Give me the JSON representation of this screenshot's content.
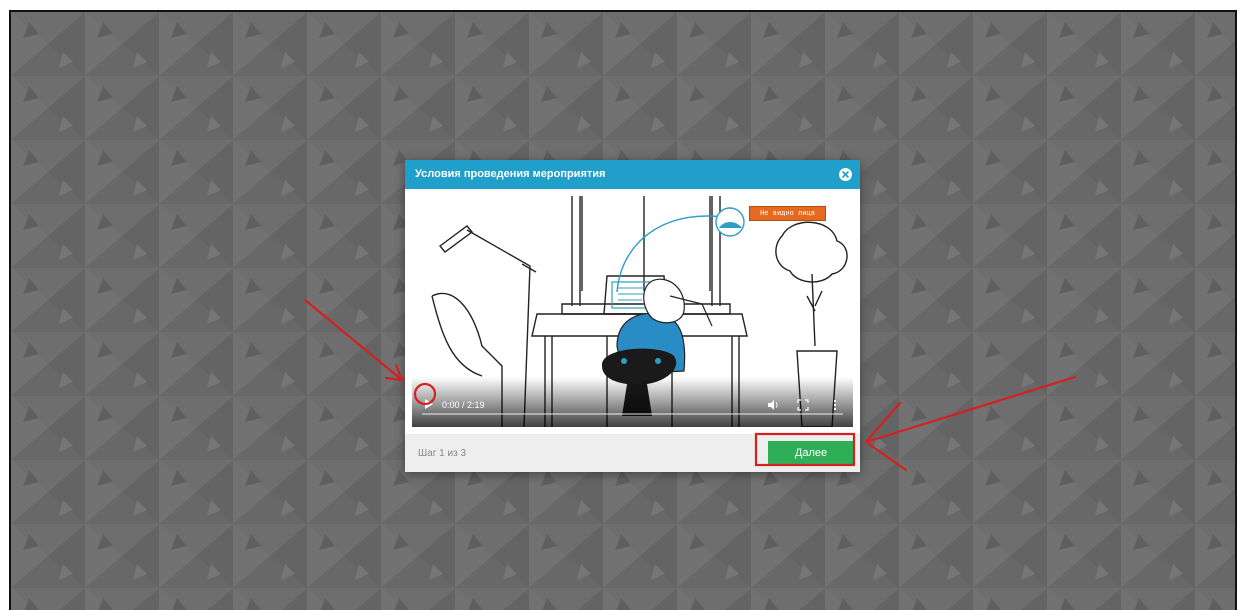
{
  "modal": {
    "title": "Условия проведения мероприятия",
    "close_icon": "close-icon"
  },
  "video": {
    "annotation_label": "Не видно лица",
    "time": "0:00 / 2:19",
    "progress": 0,
    "icons": [
      "play-icon",
      "volume-icon",
      "fullscreen-icon",
      "more-options-icon"
    ]
  },
  "footer": {
    "step_text": "Шаг 1 из 3",
    "next_label": "Далее"
  },
  "colors": {
    "header": "#1f9fc9",
    "next_button": "#2fae58",
    "annotation_red": "#d42020",
    "label_orange": "#e56a1f"
  }
}
